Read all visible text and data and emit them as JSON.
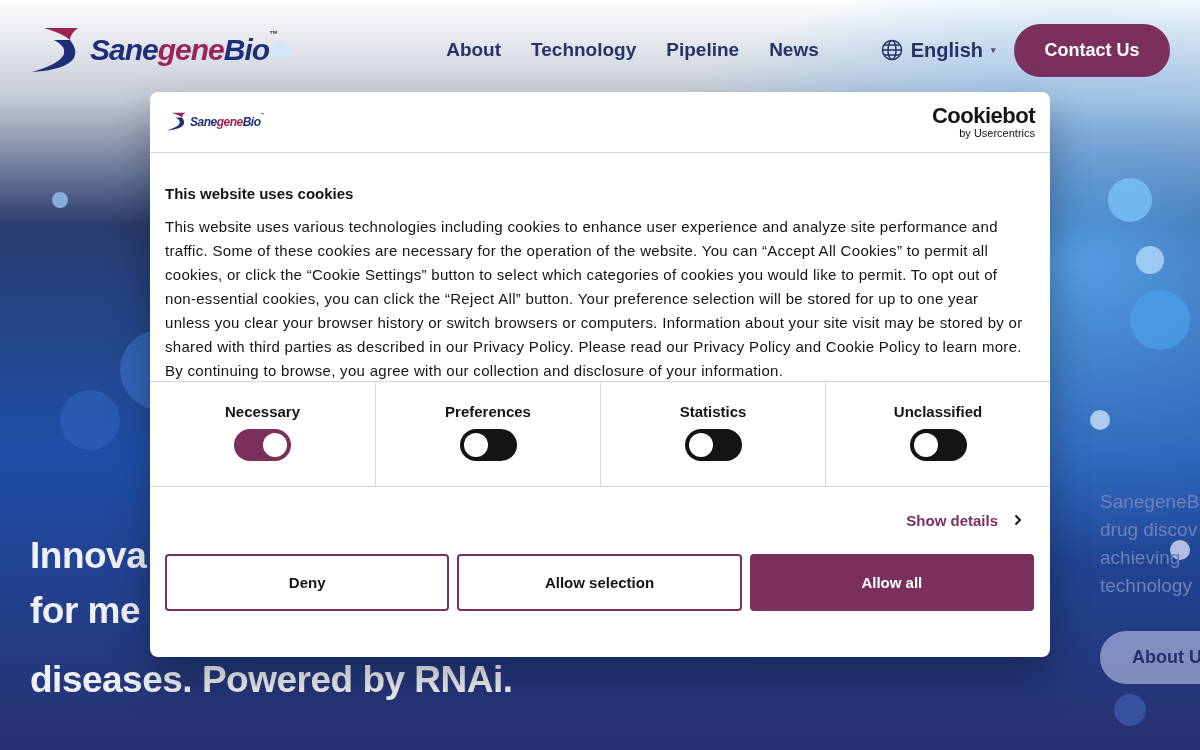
{
  "header": {
    "logo": {
      "parts": [
        "Sane",
        "gene",
        "Bio"
      ],
      "trademark": "™"
    },
    "nav": [
      {
        "label": "About"
      },
      {
        "label": "Technology"
      },
      {
        "label": "Pipeline"
      },
      {
        "label": "News"
      }
    ],
    "language": {
      "label": "English",
      "caret": "▾"
    },
    "contact_button": "Contact Us"
  },
  "hero": {
    "headline": [
      "Innova",
      "for me",
      "diseases. Powered by RNAi."
    ],
    "intro": [
      "SanegeneB",
      "drug discov",
      "achieving",
      "technology"
    ],
    "button": "About U"
  },
  "cookie_dialog": {
    "logo": {
      "parts": [
        "Sane",
        "gene",
        "Bio"
      ],
      "trademark": "™"
    },
    "provider": {
      "name": "Cookiebot",
      "byline": "by Usercentrics"
    },
    "title": "This website uses cookies",
    "body": "This website uses various technologies including cookies to enhance user experience and analyze site performance and traffic. Some of these cookies are necessary for the operation of the website. You can “Accept All Cookies” to permit all cookies, or click the “Cookie Settings” button to select which categories of cookies you would like to permit. To opt out of non-essential cookies, you can click the “Reject All” button. Your preference selection will be stored for up to one year unless you clear your browser history or switch browsers or computers. Information about your site visit may be stored by or shared with third parties as described in our Privacy Policy. Please read our Privacy Policy and Cookie Policy to learn more. By continuing to browse, you agree with our collection and disclosure of your information.",
    "consents": [
      {
        "label": "Necessary",
        "on": true
      },
      {
        "label": "Preferences",
        "on": false
      },
      {
        "label": "Statistics",
        "on": false
      },
      {
        "label": "Unclassified",
        "on": false
      }
    ],
    "show_details": "Show details",
    "buttons": [
      {
        "label": "Deny",
        "kind": "outline"
      },
      {
        "label": "Allow selection",
        "kind": "outline"
      },
      {
        "label": "Allow all",
        "kind": "filled"
      }
    ]
  }
}
